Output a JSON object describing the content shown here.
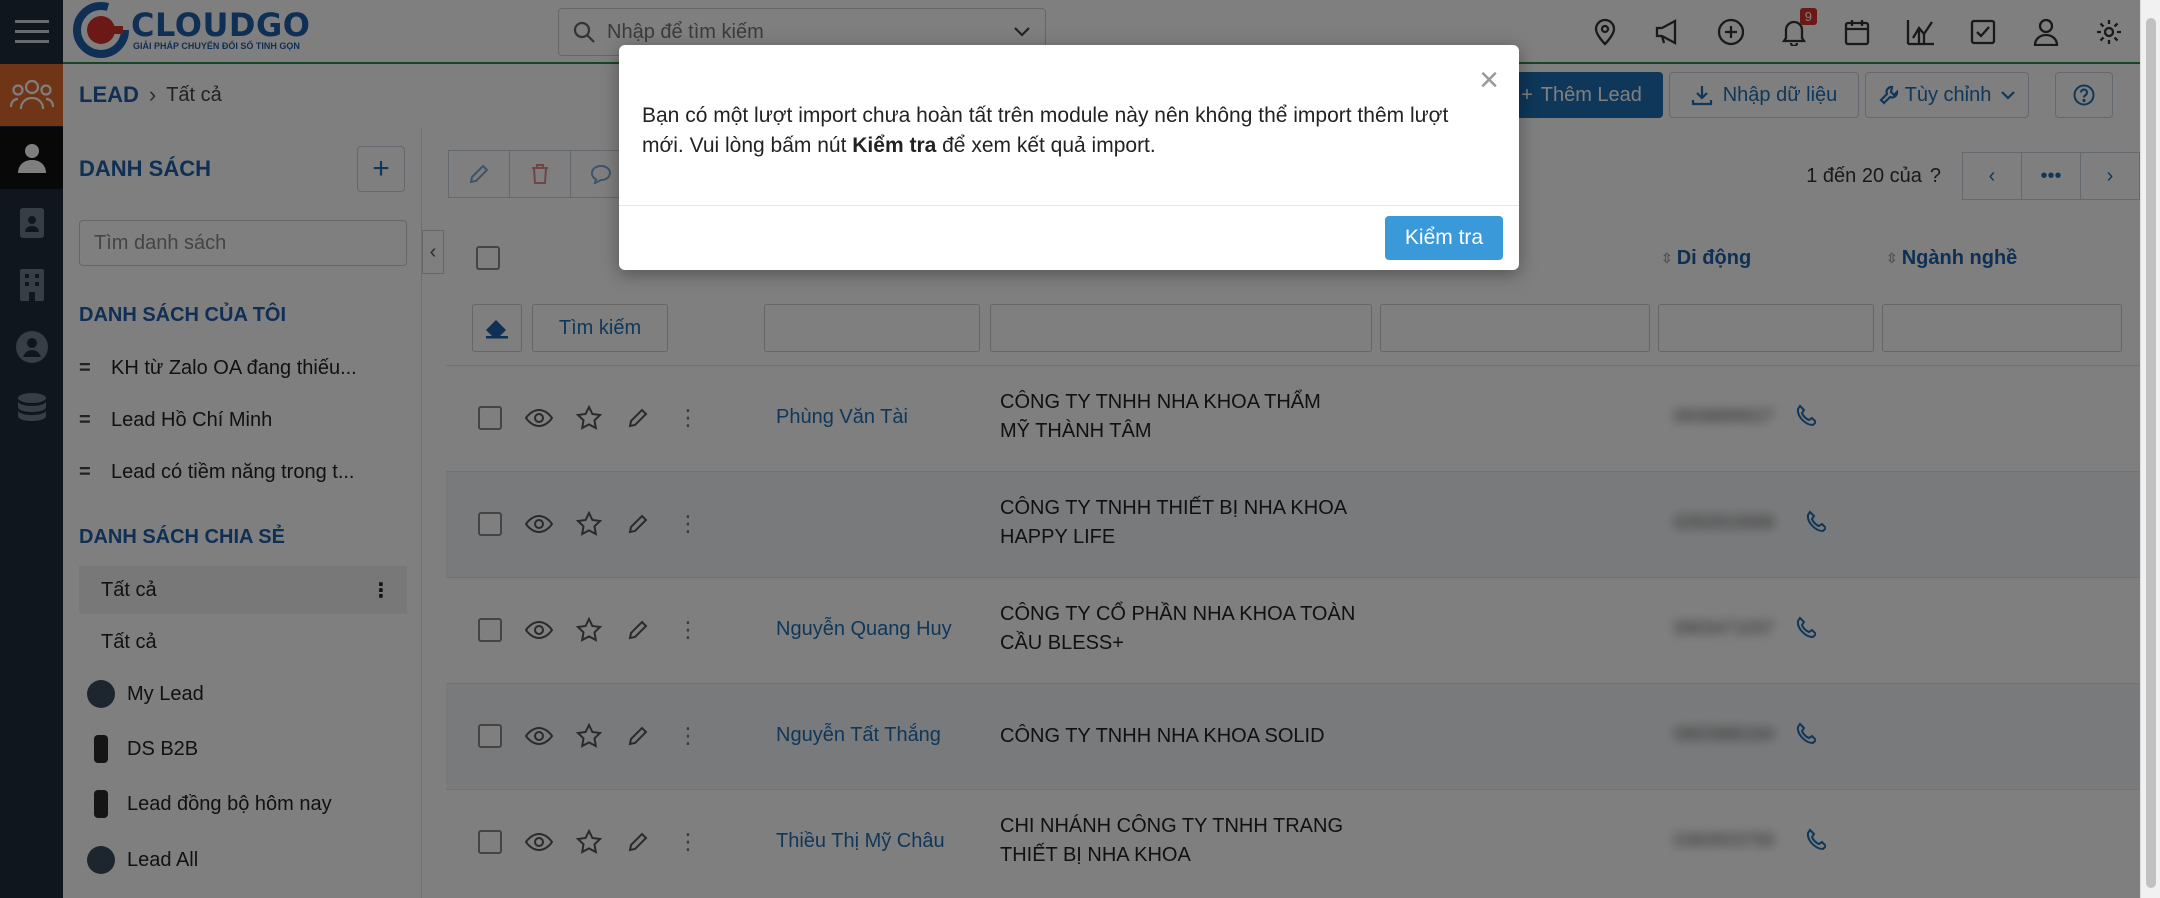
{
  "app": {
    "brand_name": "CLOUDGO",
    "brand_tagline": "GIẢI PHÁP CHUYỂN ĐỔI SỐ TINH GỌN"
  },
  "header": {
    "search_placeholder": "Nhập để tìm kiếm",
    "notification_count": "9"
  },
  "breadcrumb": {
    "module": "LEAD",
    "current": "Tất cả"
  },
  "toolbar": {
    "add_lead": "Thêm Lead",
    "import": "Nhập dữ liệu",
    "customize": "Tùy chỉnh"
  },
  "list_panel": {
    "title": "DANH SÁCH",
    "search_placeholder": "Tìm danh sách",
    "my_lists_title": "DANH SÁCH CỦA TÔI",
    "my_lists": [
      "KH từ Zalo OA đang thiếu...",
      "Lead Hồ Chí Minh",
      "Lead có tiềm năng trong t..."
    ],
    "shared_title": "DANH SÁCH CHIA SẺ",
    "shared_lists": [
      "Tất cả",
      "Tất cả",
      "My Lead",
      "DS B2B",
      "Lead đồng bộ hôm nay",
      "Lead All"
    ]
  },
  "table": {
    "pager_text": "1 đến 20 của",
    "pager_unknown": "?",
    "columns": {
      "mobile": "Di động",
      "industry": "Ngành nghề"
    },
    "search_button": "Tìm kiếm",
    "rows": [
      {
        "name": "Phùng Văn Tài",
        "company_l1": "CÔNG TY TNHH NHA KHOA THẨM",
        "company_l2": "MỸ THÀNH TÂM",
        "phone": "0938889027"
      },
      {
        "name": "",
        "company_l1": "CÔNG TY TNHH THIẾT BỊ NHA KHOA",
        "company_l2": "HAPPY LIFE",
        "phone": "0282810068"
      },
      {
        "name": "Nguyễn Quang Huy",
        "company_l1": "CÔNG TY CỔ PHẦN NHA KHOA TOÀN",
        "company_l2": "CẦU BLESS+",
        "phone": "0903471037"
      },
      {
        "name": "Nguyễn Tất Thắng",
        "company_l1": "CÔNG TY TNHH NHA KHOA SOLID",
        "company_l2": "",
        "phone": "0903986164"
      },
      {
        "name": "Thiều Thị Mỹ Châu",
        "company_l1": "CHI NHÁNH CÔNG TY TNHH TRANG",
        "company_l2": "THIẾT BỊ NHA KHOA",
        "phone": "0383933750"
      }
    ]
  },
  "modal": {
    "message_part1": "Bạn có một lượt import chưa hoàn tất trên module này nên không thể import thêm lượt mới. Vui lòng bấm nút ",
    "message_bold": "Kiểm tra",
    "message_part2": " để xem kết quả import.",
    "check_button": "Kiểm tra",
    "close_symbol": "×"
  }
}
